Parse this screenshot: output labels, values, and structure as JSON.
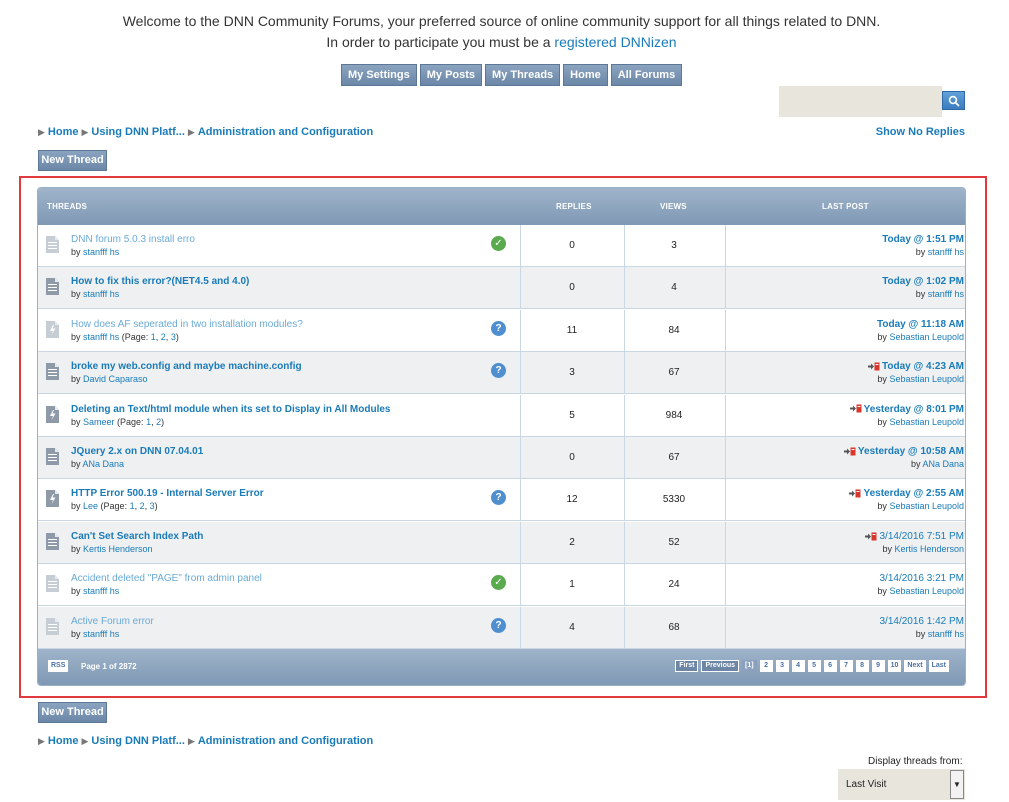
{
  "welcome": {
    "line1": "Welcome to the DNN Community Forums, your preferred source of online community support for all things related to DNN.",
    "line2_prefix": "In order to participate you must be a",
    "line2_link": "registered DNNizen"
  },
  "nav": [
    "My Settings",
    "My Posts",
    "My Threads",
    "Home",
    "All Forums"
  ],
  "search": {
    "placeholder": ""
  },
  "breadcrumb": [
    "Home",
    "Using DNN Platf...",
    "Administration and Configuration"
  ],
  "show_no_replies": "Show No Replies",
  "new_thread": "New Thread",
  "table": {
    "headers": {
      "threads": "THREADS",
      "replies": "REPLIES",
      "views": "VIEWS",
      "last_post": "LAST POST"
    },
    "rows": [
      {
        "title": "DNN forum 5.0.3 install erro",
        "by_prefix": "by",
        "author": "stanfff hs",
        "pages": [],
        "status": "answered",
        "replies": "0",
        "views": "3",
        "lp_date": "Today @ 1:51 PM",
        "lp_author": "stanfff hs",
        "read": true,
        "new_post": false,
        "lp_bold": true,
        "icon": "doc"
      },
      {
        "title": "How to fix this error?(NET4.5 and 4.0)",
        "by_prefix": "by",
        "author": "stanfff hs",
        "pages": [],
        "status": "",
        "replies": "0",
        "views": "4",
        "lp_date": "Today @ 1:02 PM",
        "lp_author": "stanfff hs",
        "read": false,
        "new_post": false,
        "lp_bold": true,
        "icon": "doc"
      },
      {
        "title": "How does AF seperated in two installation modules?",
        "by_prefix": "by",
        "author": "stanfff hs",
        "pages": [
          "1",
          "2",
          "3"
        ],
        "status": "question",
        "replies": "11",
        "views": "84",
        "lp_date": "Today @ 11:18 AM",
        "lp_author": "Sebastian Leupold",
        "read": true,
        "new_post": false,
        "lp_bold": true,
        "icon": "hot"
      },
      {
        "title": "broke my web.config and maybe machine.config",
        "by_prefix": "by",
        "author": "David Caparaso",
        "pages": [],
        "status": "question",
        "replies": "3",
        "views": "67",
        "lp_date": "Today @ 4:23 AM",
        "lp_author": "Sebastian Leupold",
        "read": false,
        "new_post": true,
        "lp_bold": true,
        "icon": "doc"
      },
      {
        "title": "Deleting an Text/html module when its set to Display in All Modules",
        "by_prefix": "by",
        "author": "Sameer",
        "pages": [
          "1",
          "2"
        ],
        "status": "",
        "replies": "5",
        "views": "984",
        "lp_date": "Yesterday @ 8:01 PM",
        "lp_author": "Sebastian Leupold",
        "read": false,
        "new_post": true,
        "lp_bold": true,
        "icon": "hot"
      },
      {
        "title": "JQuery 2.x on DNN 07.04.01",
        "by_prefix": "by",
        "author": "ANa Dana",
        "pages": [],
        "status": "",
        "replies": "0",
        "views": "67",
        "lp_date": "Yesterday @ 10:58 AM",
        "lp_author": "ANa Dana",
        "read": false,
        "new_post": true,
        "lp_bold": true,
        "icon": "doc"
      },
      {
        "title": "HTTP Error 500.19 - Internal Server Error",
        "by_prefix": "by",
        "author": "Lee",
        "pages": [
          "1",
          "2",
          "3"
        ],
        "status": "question",
        "replies": "12",
        "views": "5330",
        "lp_date": "Yesterday @ 2:55 AM",
        "lp_author": "Sebastian Leupold",
        "read": false,
        "new_post": true,
        "lp_bold": true,
        "icon": "hot"
      },
      {
        "title": "Can't Set Search Index Path",
        "by_prefix": "by",
        "author": "Kertis Henderson",
        "pages": [],
        "status": "",
        "replies": "2",
        "views": "52",
        "lp_date": "3/14/2016 7:51 PM",
        "lp_author": "Kertis Henderson",
        "read": false,
        "new_post": true,
        "lp_bold": false,
        "icon": "doc"
      },
      {
        "title": "Accident deleted \"PAGE\" from admin panel",
        "by_prefix": "by",
        "author": "stanfff hs",
        "pages": [],
        "status": "answered",
        "replies": "1",
        "views": "24",
        "lp_date": "3/14/2016 3:21 PM",
        "lp_author": "Sebastian Leupold",
        "read": true,
        "new_post": false,
        "lp_bold": false,
        "icon": "doc"
      },
      {
        "title": "Active Forum error",
        "by_prefix": "by",
        "author": "stanfff hs",
        "pages": [],
        "status": "question",
        "replies": "4",
        "views": "68",
        "lp_date": "3/14/2016 1:42 PM",
        "lp_author": "stanfff hs",
        "read": true,
        "new_post": false,
        "lp_bold": false,
        "icon": "doc"
      }
    ],
    "footer": {
      "rss": "RSS",
      "page_info": "Page 1 of 2872",
      "pager": [
        "First",
        "Previous",
        "[1]",
        "2",
        "3",
        "4",
        "5",
        "6",
        "7",
        "8",
        "9",
        "10",
        "Next",
        "Last"
      ]
    }
  },
  "display_threads": {
    "label": "Display threads from:",
    "selected": "Last Visit"
  },
  "colors": {
    "accent": "#1a7bb9",
    "header": "#8aa3bf",
    "frame": "#e0393e"
  }
}
